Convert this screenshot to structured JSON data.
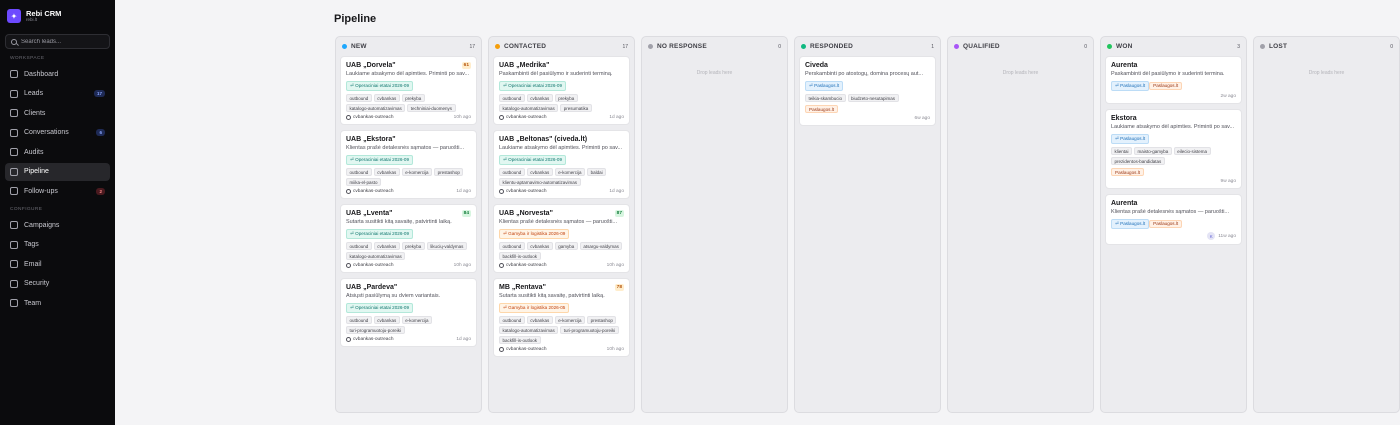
{
  "brand": {
    "name": "Rebi CRM",
    "sub": "rebi.lt"
  },
  "search": {
    "placeholder": "Search leads..."
  },
  "sidebar": {
    "workspace_label": "WORKSPACE",
    "configure_label": "CONFIGURE",
    "workspace_items": [
      {
        "label": "Dashboard",
        "badge": ""
      },
      {
        "label": "Leads",
        "badge": "17"
      },
      {
        "label": "Clients",
        "badge": ""
      },
      {
        "label": "Conversations",
        "badge": "6"
      },
      {
        "label": "Audits",
        "badge": ""
      },
      {
        "label": "Pipeline",
        "badge": ""
      },
      {
        "label": "Follow-ups",
        "badge": "2"
      }
    ],
    "configure_items": [
      {
        "label": "Campaigns"
      },
      {
        "label": "Tags"
      },
      {
        "label": "Email"
      },
      {
        "label": "Security"
      },
      {
        "label": "Team"
      }
    ]
  },
  "page": {
    "title": "Pipeline"
  },
  "columns": [
    {
      "name": "NEW",
      "count": "17",
      "color": "#1ea7fd",
      "drop": "",
      "cards": [
        {
          "title": "UAB „Dorvela\"",
          "score": "61",
          "score_class": "orange",
          "desc": "Laukiame atsakymo dėl apimties. Priminti po sav...",
          "stage": "⏎ Operaciniai etatai 2026-09",
          "stage_class": "teal",
          "tags": [
            "outbound",
            "cvbankas",
            "prekyba",
            "katalogo-automatizavimas",
            "techniniai-duomenys"
          ],
          "owner": "",
          "campaign": "cvbankas-outreach",
          "ago": "10h ago",
          "avatar": ""
        },
        {
          "title": "UAB „Ekstora\"",
          "score": "",
          "score_class": "",
          "desc": "Klientas prašė detalesnės sąmatos — paruošti...",
          "stage": "⏎ Operaciniai etatai 2026-09",
          "stage_class": "teal",
          "tags": [
            "outbound",
            "cvbankas",
            "e-komercija",
            "prestashop",
            "miika-el-pasto"
          ],
          "owner": "",
          "campaign": "cvbankas-outreach",
          "ago": "1d ago",
          "avatar": ""
        },
        {
          "title": "UAB „Lventa\"",
          "score": "84",
          "score_class": "green",
          "desc": "Sutarta susitikti kitą savaitę, patvirtinti laiką.",
          "stage": "⏎ Operaciniai etatai 2026-09",
          "stage_class": "teal",
          "tags": [
            "outbound",
            "cvbankas",
            "prekyba",
            "likucių-valdymas",
            "katalogo-automatizavimas"
          ],
          "owner": "",
          "campaign": "cvbankas-outreach",
          "ago": "10h ago",
          "avatar": ""
        },
        {
          "title": "UAB „Pardeva\"",
          "score": "",
          "score_class": "",
          "desc": "Atsiųsti pasiūlymą su dviem variantais.",
          "stage": "⏎ Operaciniai etatai 2026-09",
          "stage_class": "teal",
          "tags": [
            "outbound",
            "cvbankas",
            "e-komercija",
            "turi-programuotoju-poreiki"
          ],
          "owner": "",
          "campaign": "cvbankas-outreach",
          "ago": "1d ago",
          "avatar": ""
        }
      ]
    },
    {
      "name": "CONTACTED",
      "count": "17",
      "color": "#f59e0b",
      "drop": "",
      "cards": [
        {
          "title": "UAB „Medrika\"",
          "score": "",
          "score_class": "",
          "desc": "Paskambinti dėl pasiūlymo ir suderinti terminą.",
          "stage": "⏎ Operaciniai etatai 2026-09",
          "stage_class": "teal",
          "tags": [
            "outbound",
            "cvbankas",
            "prekyba",
            "katalogo-automatizavimas",
            "presumatika"
          ],
          "owner": "",
          "campaign": "cvbankas-outreach",
          "ago": "1d ago",
          "avatar": ""
        },
        {
          "title": "UAB „Beltonas\" (civeda.lt)",
          "score": "",
          "score_class": "",
          "desc": "Laukiame atsakymo dėl apimties. Priminti po sav...",
          "stage": "⏎ Operaciniai etatai 2026-09",
          "stage_class": "teal",
          "tags": [
            "outbound",
            "cvbankas",
            "e-komercija",
            "baldai",
            "klientu-aptarnavimo-automatizavimas"
          ],
          "owner": "",
          "campaign": "cvbankas-outreach",
          "ago": "1d ago",
          "avatar": ""
        },
        {
          "title": "UAB „Norvesta\"",
          "score": "87",
          "score_class": "green",
          "desc": "Klientas prašė detalesnės sąmatos — paruošti...",
          "stage": "⏎ Gamyba ir logistika 2026-09",
          "stage_class": "orange",
          "tags": [
            "outbound",
            "cvbankas",
            "gamyba",
            "atsargu-valdymas",
            "backfill-is-outlook"
          ],
          "owner": "",
          "campaign": "cvbankas-outreach",
          "ago": "10h ago",
          "avatar": ""
        },
        {
          "title": "MB „Rentava\"",
          "score": "78",
          "score_class": "orange",
          "desc": "Sutarta susitikti kitą savaitę, patvirtinti laiką.",
          "stage": "⏎ Gamyba ir logistika 2026-05",
          "stage_class": "orange",
          "tags": [
            "outbound",
            "cvbankas",
            "e-komercija",
            "prestashop",
            "katalogo-automatizavimas",
            "turi-programuotoju-poreiki",
            "backfill-is-outlook"
          ],
          "owner": "",
          "campaign": "cvbankas-outreach",
          "ago": "10h ago",
          "avatar": ""
        }
      ]
    },
    {
      "name": "NO RESPONSE",
      "count": "0",
      "color": "#a1a1aa",
      "drop": "Drop leads here",
      "cards": []
    },
    {
      "name": "RESPONDED",
      "count": "1",
      "color": "#10b981",
      "drop": "",
      "cards": [
        {
          "title": "Civeda",
          "score": "",
          "score_class": "",
          "desc": "Perskambinti po atostogų, domina procesų aut...",
          "stage": "⏎ Paslaugos.lt",
          "stage_class": "blue",
          "tags": [
            "teikia-skambucio",
            "biudzeto-nesutapimas"
          ],
          "owner": "Paslaugos.lt",
          "campaign": "",
          "ago": "6w ago",
          "avatar": ""
        }
      ]
    },
    {
      "name": "QUALIFIED",
      "count": "0",
      "color": "#a855f7",
      "drop": "Drop leads here",
      "cards": []
    },
    {
      "name": "WON",
      "count": "3",
      "color": "#22c55e",
      "drop": "",
      "cards": [
        {
          "title": "Aurenta",
          "score": "",
          "score_class": "",
          "desc": "Paskambinti dėl pasiūlymo ir suderinti termina.",
          "stage": "⏎ Paslaugos.lt",
          "stage_class": "blue",
          "tags": [],
          "owner": "Paslaugos.lt",
          "campaign": "",
          "ago": "2w ago",
          "avatar": ""
        },
        {
          "title": "Ekstora",
          "score": "",
          "score_class": "",
          "desc": "Laukiame atsakymo dėl apimties. Priminti po sav...",
          "stage": "⏎ Paslaugos.lt",
          "stage_class": "blue",
          "tags": [
            "klientai",
            "maisto-gamyba",
            "eilecio-sistema",
            "prezidentos-bandidatas"
          ],
          "owner": "Paslaugos.lt",
          "campaign": "",
          "ago": "9w ago",
          "avatar": ""
        },
        {
          "title": "Aurenta",
          "score": "",
          "score_class": "",
          "desc": "Klientas prašė detalesnės sąmatos — paruošti...",
          "stage": "⏎ Paslaugos.lt",
          "stage_class": "blue",
          "tags": [],
          "owner": "Paslaugos.lt",
          "campaign": "",
          "ago": "11w ago",
          "avatar": "K"
        }
      ]
    },
    {
      "name": "LOST",
      "count": "0",
      "color": "#a1a1aa",
      "drop": "Drop leads here",
      "cards": []
    }
  ]
}
